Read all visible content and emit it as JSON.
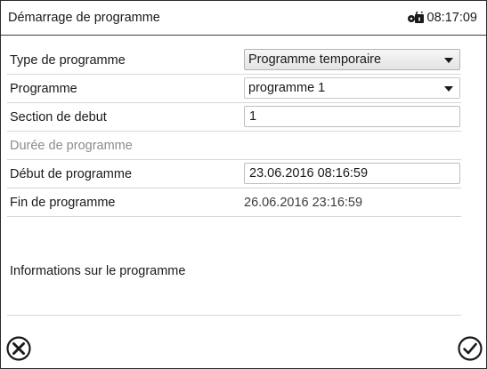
{
  "header": {
    "title": "Démarrage de programme",
    "time": "08:17:09",
    "lock_icon": "lock-open-key-icon"
  },
  "rows": {
    "program_type": {
      "label": "Type de programme",
      "value": "Programme temporaire"
    },
    "program": {
      "label": "Programme",
      "value": "programme 1"
    },
    "section": {
      "label": "Section de debut",
      "value": "1"
    },
    "duration": {
      "label": "Durée de programme"
    },
    "start": {
      "label": "Début de programme",
      "value": "23.06.2016 08:16:59"
    },
    "end": {
      "label": "Fin de programme",
      "value": "26.06.2016 23:16:59"
    }
  },
  "info": {
    "label": "Informations sur le programme"
  },
  "footer": {
    "cancel_icon": "close-circle-icon",
    "confirm_icon": "check-circle-icon"
  }
}
